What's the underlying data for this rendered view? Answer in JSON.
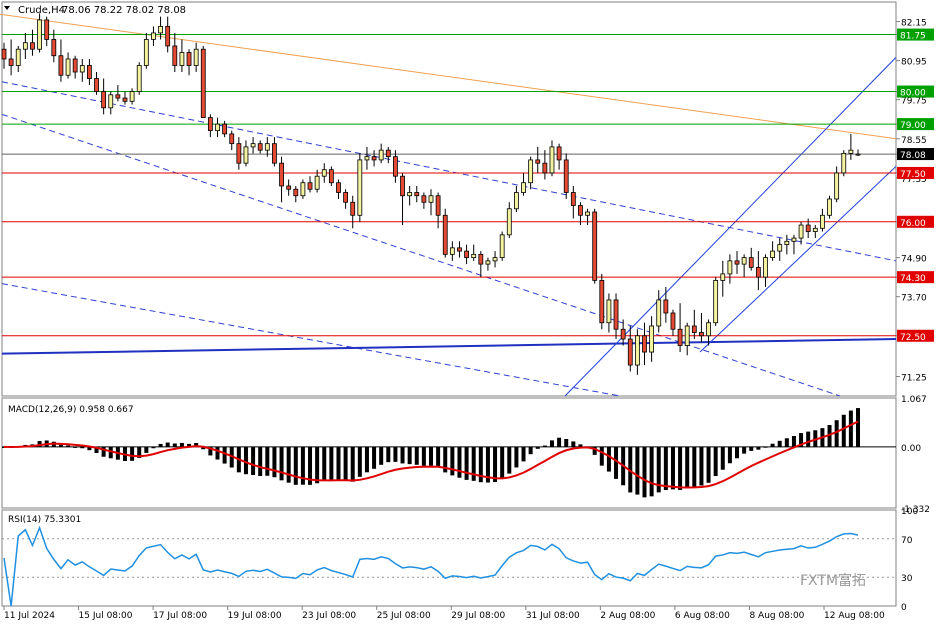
{
  "header": {
    "symbol": "Crude,H4",
    "ohlc": "78.06 78.22 78.02 78.08"
  },
  "watermark": "FXTM富拓",
  "chart_data": {
    "type": "candlestick",
    "price_axis": {
      "min": 70.65,
      "max": 82.75,
      "ticks": [
        "82.15",
        "81.75",
        "80.95",
        "80.00",
        "79.75",
        "79.00",
        "78.55",
        "78.08",
        "77.35",
        "77.50",
        "76.00",
        "74.90",
        "74.30",
        "73.70",
        "72.50",
        "71.25"
      ]
    },
    "current_price": "78.08",
    "horizontal_levels": [
      {
        "price": 81.75,
        "label": "81.75",
        "color": "#00a000"
      },
      {
        "price": 80.0,
        "label": "80.00",
        "color": "#00a000"
      },
      {
        "price": 79.0,
        "label": "79.00",
        "color": "#00a000"
      },
      {
        "price": 77.5,
        "label": "77.50",
        "color": "#e00000"
      },
      {
        "price": 76.0,
        "label": "76.00",
        "color": "#e00000"
      },
      {
        "price": 74.3,
        "label": "74.30",
        "color": "#e00000"
      },
      {
        "price": 72.5,
        "label": "72.50",
        "color": "#e00000"
      }
    ],
    "x_labels": [
      "11 Jul 2024",
      "15 Jul 08:00",
      "17 Jul 08:00",
      "19 Jul 08:00",
      "23 Jul 08:00",
      "25 Jul 08:00",
      "29 Jul 08:00",
      "31 Jul 08:00",
      "2 Aug 08:00",
      "6 Aug 08:00",
      "8 Aug 08:00",
      "12 Aug 08:00"
    ],
    "candles": [
      [
        81.3,
        81.5,
        80.7,
        81.0
      ],
      [
        81.0,
        81.6,
        80.5,
        80.8
      ],
      [
        80.8,
        81.4,
        80.6,
        81.3
      ],
      [
        81.3,
        81.8,
        81.0,
        81.5
      ],
      [
        81.5,
        81.9,
        81.1,
        81.3
      ],
      [
        81.3,
        82.4,
        81.2,
        82.2
      ],
      [
        82.2,
        82.3,
        81.4,
        81.6
      ],
      [
        81.6,
        81.9,
        80.9,
        81.1
      ],
      [
        81.1,
        81.6,
        80.3,
        80.5
      ],
      [
        80.5,
        81.2,
        80.4,
        81.0
      ],
      [
        81.0,
        81.1,
        80.4,
        80.6
      ],
      [
        80.6,
        81.0,
        80.3,
        80.8
      ],
      [
        80.8,
        81.0,
        80.2,
        80.4
      ],
      [
        80.4,
        80.6,
        79.9,
        80.0
      ],
      [
        80.0,
        80.4,
        79.3,
        79.5
      ],
      [
        79.5,
        80.0,
        79.3,
        79.9
      ],
      [
        79.9,
        80.2,
        79.7,
        79.8
      ],
      [
        79.8,
        80.0,
        79.6,
        79.7
      ],
      [
        79.7,
        80.1,
        79.6,
        80.0
      ],
      [
        80.0,
        80.9,
        79.9,
        80.8
      ],
      [
        80.8,
        81.8,
        80.7,
        81.6
      ],
      [
        81.6,
        82.0,
        81.4,
        81.8
      ],
      [
        81.8,
        82.3,
        81.6,
        82.0
      ],
      [
        82.0,
        82.3,
        81.2,
        81.4
      ],
      [
        81.4,
        81.8,
        80.6,
        80.8
      ],
      [
        80.8,
        81.6,
        80.6,
        81.2
      ],
      [
        81.2,
        81.3,
        80.5,
        80.8
      ],
      [
        80.8,
        81.5,
        80.6,
        81.3
      ],
      [
        81.3,
        81.4,
        79.2,
        79.2
      ],
      [
        79.2,
        79.3,
        78.6,
        78.8
      ],
      [
        78.8,
        79.2,
        78.6,
        79.0
      ],
      [
        79.0,
        79.1,
        78.6,
        78.7
      ],
      [
        78.7,
        78.8,
        78.2,
        78.4
      ],
      [
        78.4,
        78.6,
        77.6,
        77.8
      ],
      [
        77.8,
        78.5,
        77.7,
        78.3
      ],
      [
        78.3,
        78.6,
        78.1,
        78.4
      ],
      [
        78.4,
        78.5,
        78.1,
        78.2
      ],
      [
        78.2,
        78.6,
        78.0,
        78.4
      ],
      [
        78.4,
        78.6,
        77.7,
        77.8
      ],
      [
        77.8,
        78.0,
        76.6,
        77.1
      ],
      [
        77.1,
        77.3,
        76.8,
        77.0
      ],
      [
        77.0,
        77.1,
        76.6,
        76.8
      ],
      [
        76.8,
        77.3,
        76.7,
        77.2
      ],
      [
        77.2,
        77.4,
        76.9,
        77.0
      ],
      [
        77.0,
        77.6,
        76.9,
        77.4
      ],
      [
        77.4,
        77.8,
        77.2,
        77.6
      ],
      [
        77.6,
        77.7,
        77.1,
        77.2
      ],
      [
        77.2,
        77.3,
        76.7,
        76.9
      ],
      [
        76.9,
        77.0,
        76.4,
        76.6
      ],
      [
        76.6,
        76.8,
        75.8,
        76.2
      ],
      [
        76.2,
        78.1,
        76.0,
        77.9
      ],
      [
        77.9,
        78.3,
        77.6,
        78.0
      ],
      [
        78.0,
        78.2,
        77.7,
        77.9
      ],
      [
        77.9,
        78.4,
        77.8,
        78.2
      ],
      [
        78.2,
        78.3,
        77.8,
        78.0
      ],
      [
        78.0,
        78.2,
        77.2,
        77.4
      ],
      [
        77.4,
        77.5,
        75.9,
        76.8
      ],
      [
        76.8,
        77.1,
        76.5,
        76.9
      ],
      [
        76.9,
        77.1,
        76.6,
        76.8
      ],
      [
        76.8,
        76.9,
        76.4,
        76.6
      ],
      [
        76.6,
        77.0,
        76.2,
        76.8
      ],
      [
        76.8,
        76.9,
        75.8,
        76.2
      ],
      [
        76.2,
        76.4,
        74.9,
        75.0
      ],
      [
        75.0,
        75.4,
        74.8,
        75.2
      ],
      [
        75.2,
        75.4,
        74.9,
        75.1
      ],
      [
        75.1,
        75.3,
        74.7,
        74.9
      ],
      [
        74.9,
        75.3,
        74.8,
        75.0
      ],
      [
        75.0,
        75.1,
        74.3,
        74.7
      ],
      [
        74.7,
        74.9,
        74.5,
        74.8
      ],
      [
        74.8,
        75.1,
        74.6,
        74.9
      ],
      [
        74.9,
        75.7,
        74.8,
        75.6
      ],
      [
        75.6,
        76.6,
        75.5,
        76.4
      ],
      [
        76.4,
        77.1,
        76.3,
        76.9
      ],
      [
        76.9,
        77.5,
        76.8,
        77.2
      ],
      [
        77.2,
        78.0,
        77.0,
        77.9
      ],
      [
        77.9,
        78.3,
        77.5,
        77.8
      ],
      [
        77.8,
        78.2,
        77.3,
        77.5
      ],
      [
        77.5,
        78.5,
        77.4,
        78.3
      ],
      [
        78.3,
        78.4,
        77.6,
        77.9
      ],
      [
        77.9,
        78.1,
        76.7,
        76.9
      ],
      [
        76.9,
        77.1,
        76.1,
        76.5
      ],
      [
        76.5,
        76.6,
        75.9,
        76.2
      ],
      [
        76.2,
        76.4,
        75.9,
        76.3
      ],
      [
        76.3,
        76.4,
        74.1,
        74.2
      ],
      [
        74.2,
        74.4,
        72.7,
        72.9
      ],
      [
        72.9,
        73.8,
        72.6,
        73.6
      ],
      [
        73.6,
        73.8,
        72.4,
        72.7
      ],
      [
        72.7,
        73.0,
        72.2,
        72.4
      ],
      [
        72.4,
        72.8,
        71.4,
        71.6
      ],
      [
        71.6,
        72.7,
        71.3,
        72.5
      ],
      [
        72.5,
        72.9,
        71.6,
        72.0
      ],
      [
        72.0,
        73.1,
        71.7,
        72.8
      ],
      [
        72.8,
        73.9,
        72.6,
        73.6
      ],
      [
        73.6,
        74.0,
        72.9,
        73.2
      ],
      [
        73.2,
        73.3,
        72.5,
        72.7
      ],
      [
        72.7,
        73.5,
        72.0,
        72.2
      ],
      [
        72.2,
        72.9,
        71.9,
        72.8
      ],
      [
        72.8,
        73.3,
        72.4,
        72.6
      ],
      [
        72.6,
        73.2,
        72.3,
        72.5
      ],
      [
        72.5,
        73.0,
        72.2,
        72.9
      ],
      [
        72.9,
        74.3,
        72.8,
        74.2
      ],
      [
        74.2,
        74.8,
        73.7,
        74.4
      ],
      [
        74.4,
        75.0,
        74.1,
        74.8
      ],
      [
        74.8,
        75.1,
        74.4,
        74.7
      ],
      [
        74.7,
        75.0,
        74.3,
        74.9
      ],
      [
        74.9,
        75.2,
        74.5,
        74.6
      ],
      [
        74.6,
        75.1,
        73.9,
        74.3
      ],
      [
        74.3,
        75.0,
        74.0,
        74.9
      ],
      [
        74.9,
        75.4,
        74.8,
        75.1
      ],
      [
        75.1,
        75.5,
        74.8,
        75.3
      ],
      [
        75.3,
        75.6,
        75.0,
        75.4
      ],
      [
        75.4,
        75.6,
        75.0,
        75.5
      ],
      [
        75.5,
        76.0,
        75.3,
        75.9
      ],
      [
        75.9,
        76.1,
        75.5,
        75.7
      ],
      [
        75.7,
        75.9,
        75.5,
        75.8
      ],
      [
        75.8,
        76.4,
        75.7,
        76.2
      ],
      [
        76.2,
        76.8,
        76.1,
        76.7
      ],
      [
        76.7,
        77.7,
        76.6,
        77.5
      ],
      [
        77.5,
        78.2,
        77.4,
        78.1
      ],
      [
        78.1,
        78.7,
        77.9,
        78.2
      ],
      [
        78.06,
        78.22,
        78.02,
        78.08
      ]
    ],
    "macd": {
      "label": "MACD(12,26,9) 0.958 0.667",
      "ticks": [
        "1.067",
        "0.00",
        "-1.332"
      ]
    },
    "rsi": {
      "label": "RSI(14) 75.3301",
      "ticks": [
        "100",
        "70",
        "30",
        "0"
      ]
    }
  }
}
